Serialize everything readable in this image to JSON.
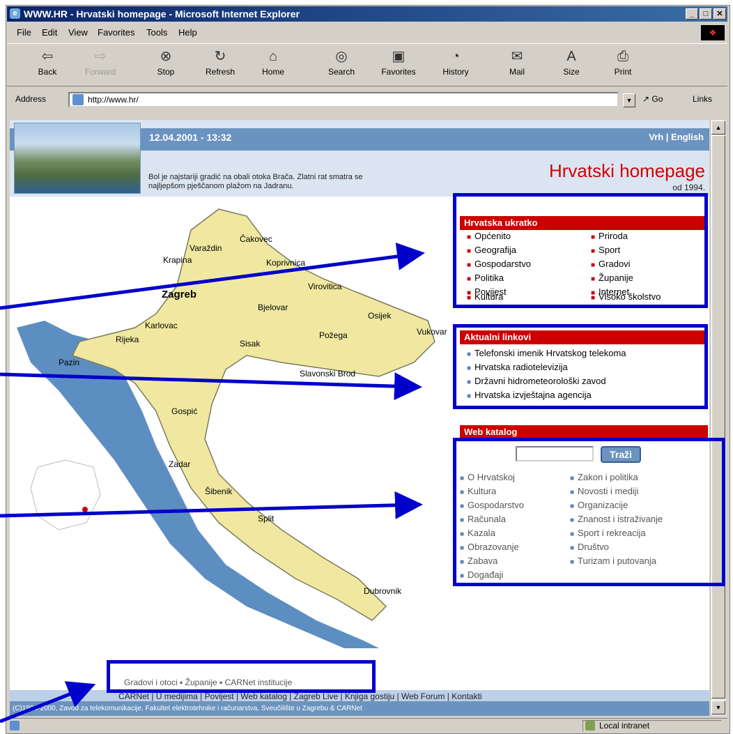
{
  "window": {
    "title": "WWW.HR - Hrvatski homepage - Microsoft Internet Explorer",
    "controls": [
      "_",
      "□",
      "✕"
    ]
  },
  "menu": [
    "File",
    "Edit",
    "View",
    "Favorites",
    "Tools",
    "Help"
  ],
  "toolbar": [
    {
      "label": "Back",
      "icon": "back-arrow-icon",
      "enabled": true
    },
    {
      "label": "Forward",
      "icon": "forward-arrow-icon",
      "enabled": false
    },
    {
      "label": "Stop",
      "icon": "stop-icon",
      "enabled": true
    },
    {
      "label": "Refresh",
      "icon": "refresh-icon",
      "enabled": true
    },
    {
      "label": "Home",
      "icon": "home-icon",
      "enabled": true
    },
    {
      "label": "Search",
      "icon": "search-icon",
      "enabled": true
    },
    {
      "label": "Favorites",
      "icon": "favorites-icon",
      "enabled": true
    },
    {
      "label": "History",
      "icon": "history-icon",
      "enabled": true
    },
    {
      "label": "Mail",
      "icon": "mail-icon",
      "enabled": true
    },
    {
      "label": "Size",
      "icon": "text-size-icon",
      "enabled": true
    },
    {
      "label": "Print",
      "icon": "printer-icon",
      "enabled": true
    }
  ],
  "address": {
    "label": "Address",
    "url": "http://www.hr/",
    "go_label": "Go",
    "links_label": "Links"
  },
  "page": {
    "date": "12.04.2001 - 13:32",
    "top_links": "Vrh | English",
    "caption": "Bol je najstariji gradić na obali otoka Brača. Zlatni rat smatra se najljepšom pješčanom plažom na Jadranu.",
    "site_title": "Hrvatski homepage",
    "since": "od 1994.",
    "map_cities": [
      "Čakovec",
      "Varaždin",
      "Krapina",
      "Koprivnica",
      "Zagreb",
      "Virovitica",
      "Bjelovar",
      "Osijek",
      "Vukovar",
      "Karlovac",
      "Sisak",
      "Požega",
      "Rijeka",
      "Pazin",
      "Slavonski Brod",
      "Gospić",
      "Zadar",
      "Šibenik",
      "Split",
      "Dubrovnik"
    ],
    "ukratko": {
      "title": "Hrvatska ukratko",
      "col1": [
        "Općenito",
        "Geografija",
        "Gospodarstvo",
        "Politika",
        "Povijest",
        "Kultura"
      ],
      "col2": [
        "Priroda",
        "Sport",
        "Gradovi",
        "Županije",
        "Internet",
        "Visoko školstvo"
      ]
    },
    "aktualni": {
      "title": "Aktualni linkovi",
      "links": [
        "Telefonski imenik Hrvatskog telekoma",
        "Hrvatska radiotelevizija",
        "Državni hidrometeorološki zavod",
        "Hrvatska izvještajna agencija"
      ]
    },
    "katalog": {
      "title": "Web katalog",
      "search_button": "Traži",
      "col1": [
        "O Hrvatskoj",
        "Kultura",
        "Gospodarstvo",
        "Računala",
        "Kazala",
        "Obrazovanje",
        "Zabava",
        "Događaji"
      ],
      "col2": [
        "Zakon i politika",
        "Novosti i mediji",
        "Organizacije",
        "Znanost i istraživanje",
        "Sport i rekreacija",
        "Društvo",
        "Turizam i putovanja"
      ]
    },
    "footer_links_1": "Gradovi i otoci ▪ Županije ▪ CARNet institucije",
    "footer_links_2": "CARNet | U medijima | Povijest | Web katalog | Zagreb Live | Knjiga gostiju | Web Forum | Kontakti",
    "copyright": "(C)1994-2000, Zavod za telekomunikacije, Fakultet elektrotehnike i računarstva, Sveučilište u Zagrebu & CARNet"
  },
  "status": {
    "zone": "Local intranet"
  },
  "colors": {
    "accent_red": "#cc0000",
    "header_blue": "#6b93bf",
    "annotation_blue": "#0000cc",
    "map_land": "#f0e8a0",
    "map_sea": "#5d8ec2"
  }
}
